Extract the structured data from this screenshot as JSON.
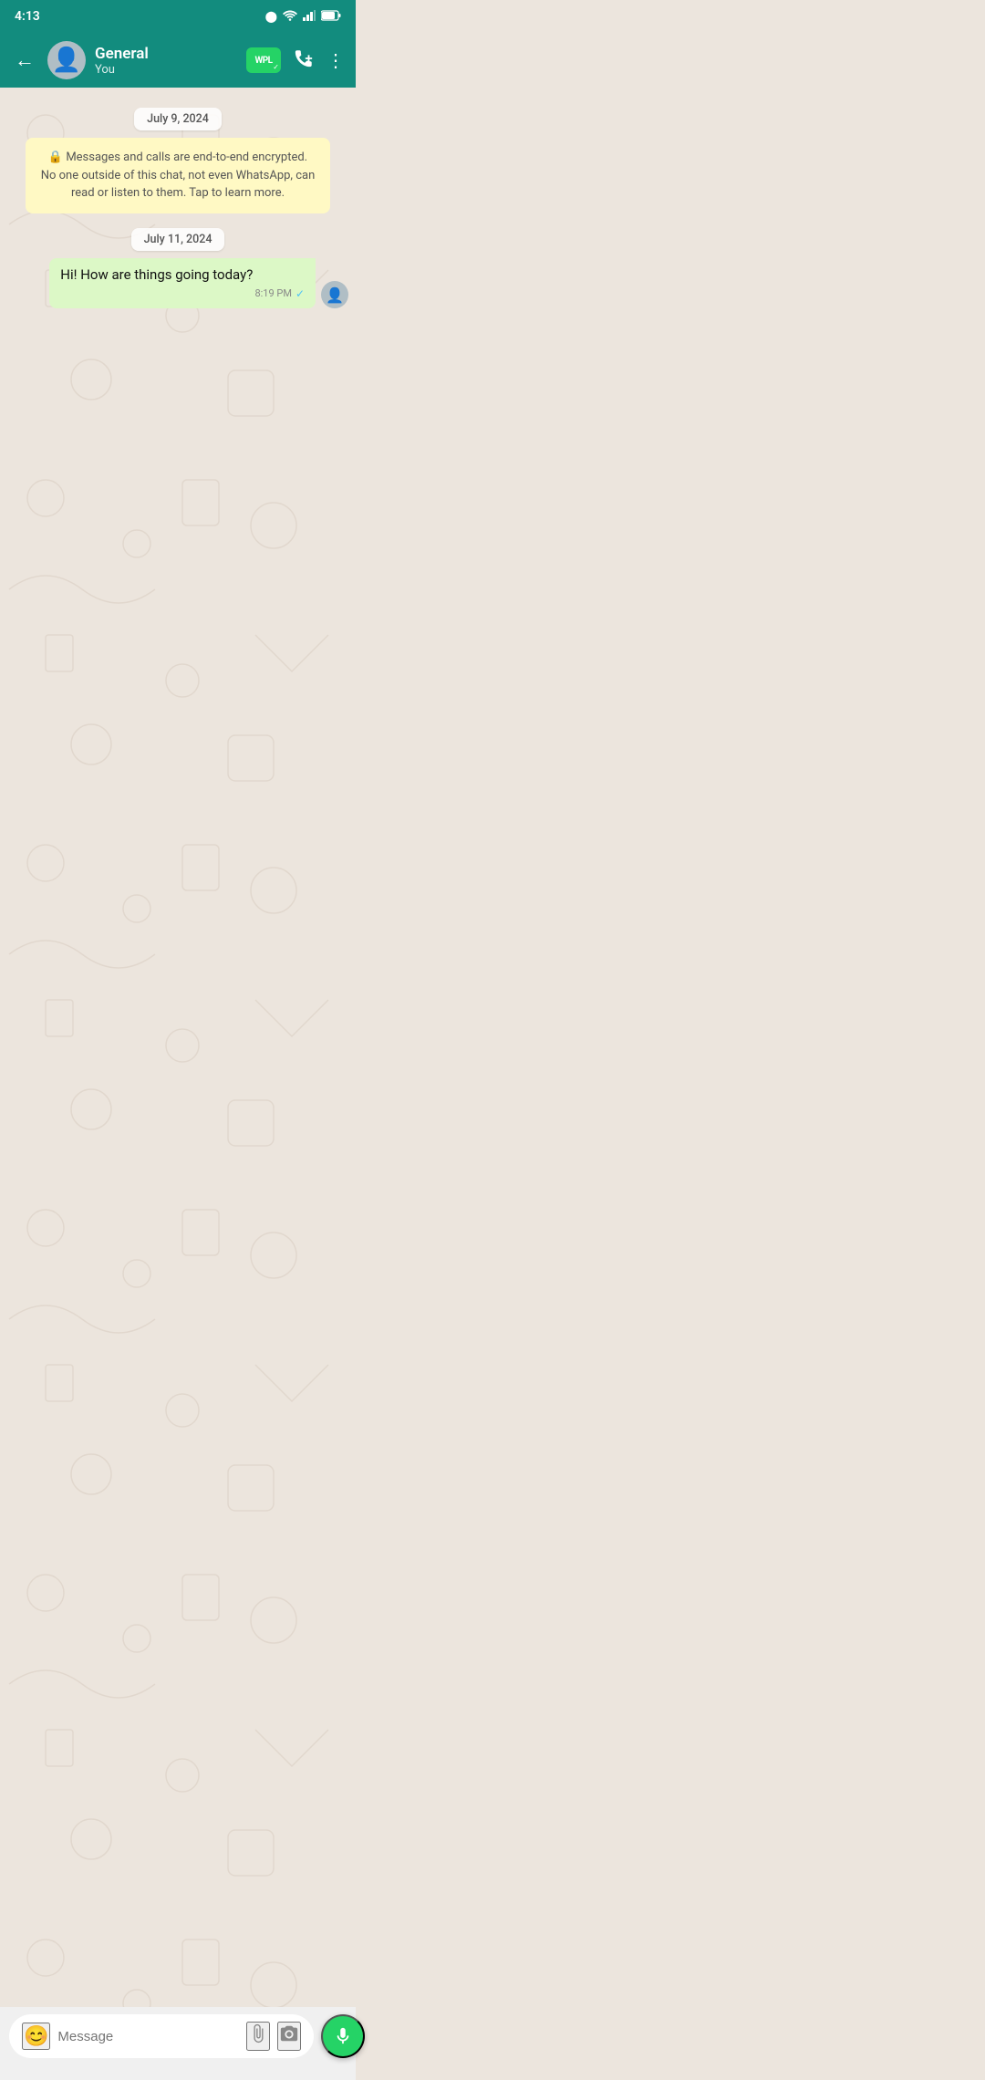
{
  "statusBar": {
    "time": "4:13",
    "cameraIcon": "📷"
  },
  "header": {
    "backLabel": "←",
    "contactName": "General",
    "subtitle": "You",
    "wplLabel": "WPL",
    "addCallLabel": "+📞",
    "moreLabel": "⋮"
  },
  "dates": {
    "date1": "July 9, 2024",
    "date2": "July 11, 2024"
  },
  "encryption": {
    "text": "Messages and calls are end-to-end encrypted. No one outside of this chat, not even WhatsApp, can read or listen to them. Tap to learn more."
  },
  "messages": [
    {
      "id": 1,
      "direction": "outgoing",
      "text": "Hi! How are things going today?",
      "time": "8:19 PM",
      "delivered": true
    }
  ],
  "inputBar": {
    "placeholder": "Message",
    "emojiIcon": "😊",
    "attachIcon": "📎",
    "cameraIcon": "📷",
    "micIcon": "🎤"
  }
}
